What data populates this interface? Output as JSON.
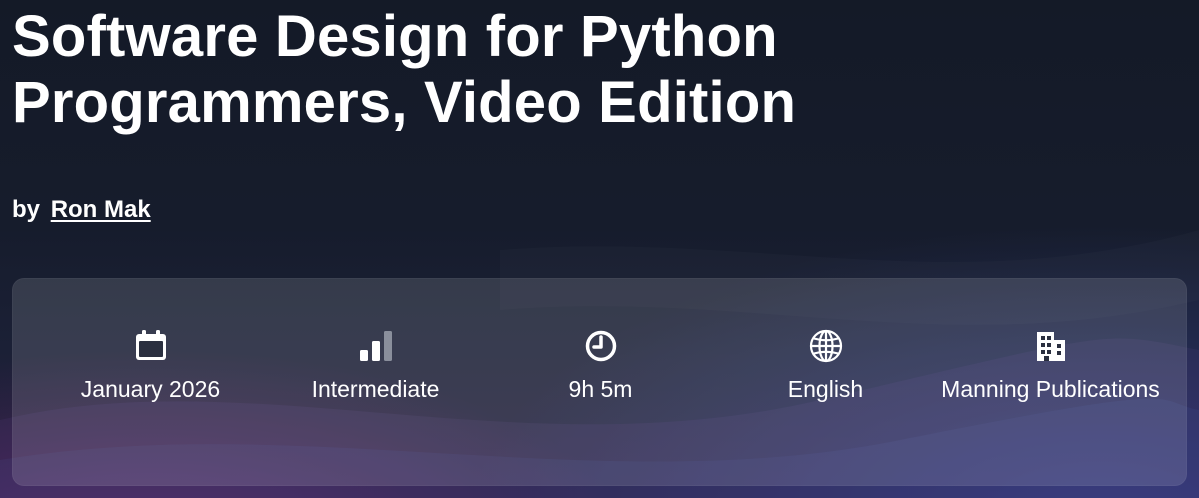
{
  "course": {
    "title": "Software Design for Python Programmers, Video Edition",
    "byline": {
      "prefix": "by",
      "author": "Ron Mak"
    }
  },
  "details": [
    {
      "icon": "calendar-icon",
      "label": "January 2026"
    },
    {
      "icon": "skill-level-icon",
      "label": "Intermediate",
      "level_filled": 2,
      "level_total": 3
    },
    {
      "icon": "clock-icon",
      "label": "9h 5m"
    },
    {
      "icon": "globe-icon",
      "label": "English"
    },
    {
      "icon": "building-icon",
      "label": "Manning Publications"
    }
  ],
  "colors": {
    "text": "#ffffff",
    "background": "#141a27",
    "card": "rgba(255,255,255,0.13)",
    "level_dim": "#8a8f9c"
  }
}
